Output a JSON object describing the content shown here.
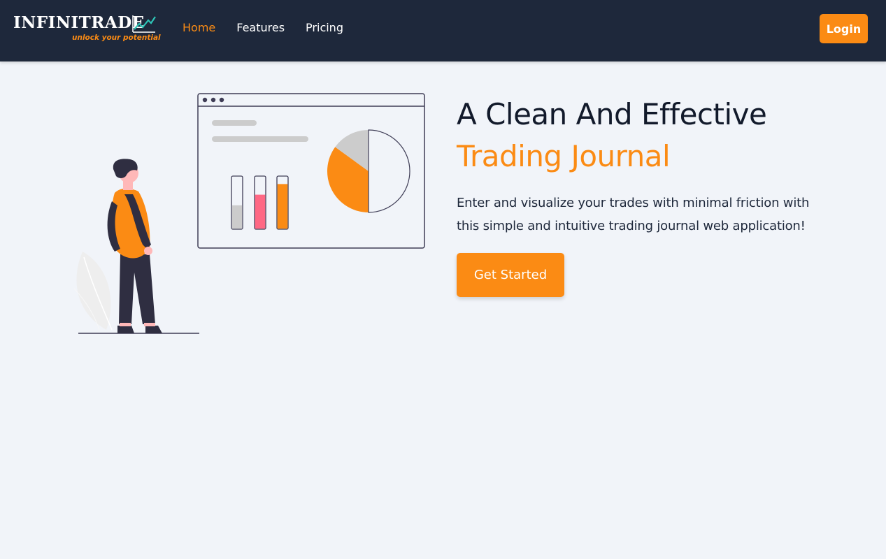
{
  "brand": {
    "name": "INFINITRADE",
    "tagline": "unlock your potential",
    "accent_color": "#fb8b14",
    "chart_color": "#2ec4b6"
  },
  "nav": {
    "links": [
      {
        "label": "Home",
        "active": true
      },
      {
        "label": "Features",
        "active": false
      },
      {
        "label": "Pricing",
        "active": false
      }
    ],
    "login_label": "Login"
  },
  "hero": {
    "title_line1": "A Clean And Effective",
    "title_line2": "Trading Journal",
    "description": "Enter and visualize your trades with minimal friction with this simple and intuitive trading journal web application!",
    "cta_label": "Get Started"
  },
  "illustration": {
    "bars": [
      {
        "fill": 0.45,
        "color": "#cccccc"
      },
      {
        "fill": 0.65,
        "color": "#ff6884"
      },
      {
        "fill": 0.85,
        "color": "#fb8b14"
      }
    ],
    "pie": [
      {
        "fraction": 0.5,
        "color": "#f1f4f9"
      },
      {
        "fraction": 0.35,
        "color": "#fb8b14"
      },
      {
        "fraction": 0.15,
        "color": "#cccccc"
      }
    ]
  }
}
